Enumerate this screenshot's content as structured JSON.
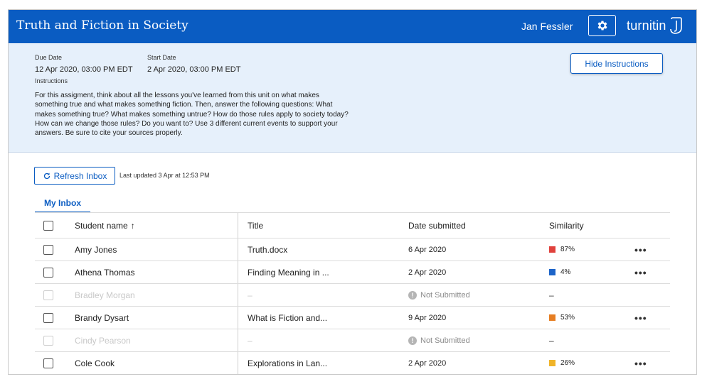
{
  "header": {
    "title": "Truth and Fiction in Society",
    "user": "Jan Fessler",
    "settings_icon": "gear-icon",
    "logo_text": "turnitin"
  },
  "assignment": {
    "due_label": "Due Date",
    "due_value": "12 Apr 2020, 03:00 PM EDT",
    "start_label": "Start Date",
    "start_value": "2 Apr 2020, 03:00 PM EDT",
    "instructions_label": "Instructions",
    "instructions_text": "For this assigment, think about all the lessons you've learned from this unit on what makes something true and what makes something fiction. Then, answer the following questions: What makes something true? What makes something untrue? How do those rules apply to society today? How can we change those rules? Do you want to? Use 3 different current events to support your answers. Be sure to cite your sources properly.",
    "hide_button": "Hide Instructions"
  },
  "toolbar": {
    "refresh_label": "Refresh Inbox",
    "last_updated": "Last updated 3 Apr at 12:53 PM"
  },
  "tabs": {
    "inbox": "My Inbox"
  },
  "table": {
    "columns": {
      "student": "Student name",
      "sort_indicator": "↑",
      "title": "Title",
      "date": "Date submitted",
      "similarity": "Similarity"
    },
    "rows": [
      {
        "name": "Amy Jones",
        "title": "Truth.docx",
        "date": "6 Apr 2020",
        "similarity": "87%",
        "color": "#e0413c",
        "submitted": true
      },
      {
        "name": "Athena Thomas",
        "title": "Finding Meaning in ...",
        "date": "2 Apr 2020",
        "similarity": "4%",
        "color": "#1c64c8",
        "submitted": true
      },
      {
        "name": "Bradley Morgan",
        "title": "–",
        "date": "Not Submitted",
        "similarity": "–",
        "color": "",
        "submitted": false
      },
      {
        "name": "Brandy Dysart",
        "title": "What is Fiction and...",
        "date": "9 Apr 2020",
        "similarity": "53%",
        "color": "#e67e22",
        "submitted": true
      },
      {
        "name": "Cindy Pearson",
        "title": "–",
        "date": "Not Submitted",
        "similarity": "–",
        "color": "",
        "submitted": false
      },
      {
        "name": "Cole Cook",
        "title": "Explorations in Lan...",
        "date": "2 Apr 2020",
        "similarity": "26%",
        "color": "#f0b429",
        "submitted": true
      }
    ],
    "more_label": "•••"
  }
}
